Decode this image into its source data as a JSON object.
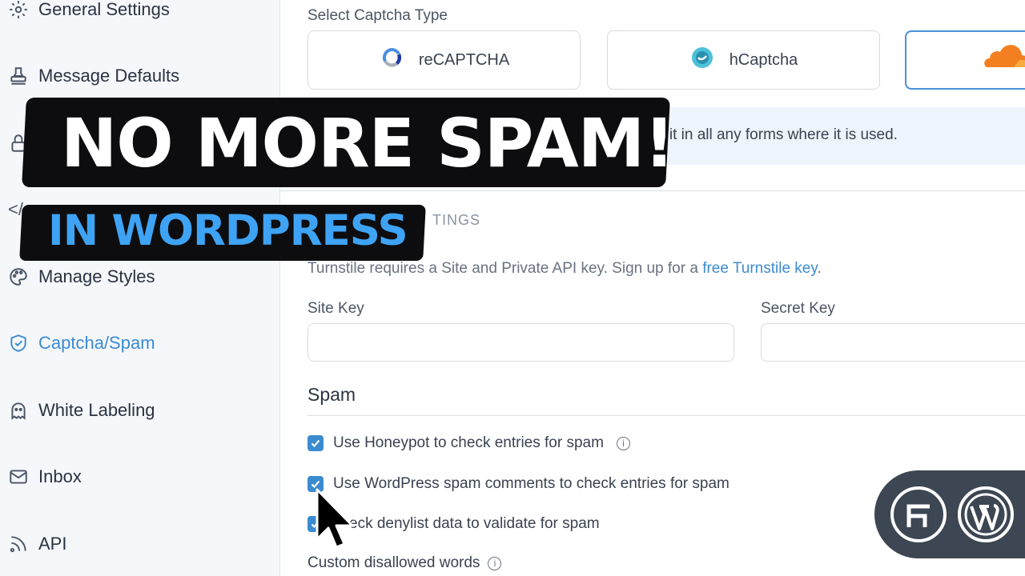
{
  "sidebar": {
    "items": [
      {
        "label": "General Settings",
        "icon": "gear-icon"
      },
      {
        "label": "Message Defaults",
        "icon": "stamp-icon"
      },
      {
        "label": "",
        "icon": "lock-icon"
      },
      {
        "label": "</",
        "icon": "code-icon"
      },
      {
        "label": "Manage Styles",
        "icon": "palette-icon"
      },
      {
        "label": "Captcha/Spam",
        "icon": "shield-check-icon",
        "active": true
      },
      {
        "label": "White Labeling",
        "icon": "ghost-icon"
      },
      {
        "label": "Inbox",
        "icon": "mail-icon"
      },
      {
        "label": "API",
        "icon": "rss-icon"
      }
    ]
  },
  "captcha": {
    "type_label": "Select Captcha Type",
    "options": [
      {
        "label": "reCAPTCHA",
        "icon": "recaptcha-icon"
      },
      {
        "label": "hCaptcha",
        "icon": "hcaptcha-icon"
      },
      {
        "label": "",
        "icon": "cloudflare-icon",
        "selected": true
      }
    ],
    "info_text": "e it in all any forms where it is used."
  },
  "turnstile": {
    "section_caption": "TINGS",
    "description": "Turnstile requires a Site and Private API key. Sign up for a ",
    "link": "free Turnstile key",
    "description_end": ".",
    "site_key_label": "Site Key",
    "site_key_value": "",
    "secret_key_label": "Secret Key",
    "secret_key_value": ""
  },
  "spam": {
    "heading": "Spam",
    "options": [
      {
        "label": "Use Honeypot to check entries for spam",
        "checked": true,
        "info": true
      },
      {
        "label": "Use WordPress spam comments to check entries for spam",
        "checked": true
      },
      {
        "label": "eck denylist data to validate for spam",
        "checked": true
      }
    ],
    "custom_words_label": "Custom disallowed words"
  },
  "overlay": {
    "headline": "NO MORE SPAM!",
    "subline": "IN WORDPRESS"
  },
  "colors": {
    "accent": "#3b8bd0",
    "banner_bg": "#0d0d0f",
    "subline": "#3ea3f5",
    "cloudflare_orange": "#f38020"
  },
  "badge": {
    "logos": [
      "formidable-logo-icon",
      "wordpress-logo-icon"
    ]
  }
}
